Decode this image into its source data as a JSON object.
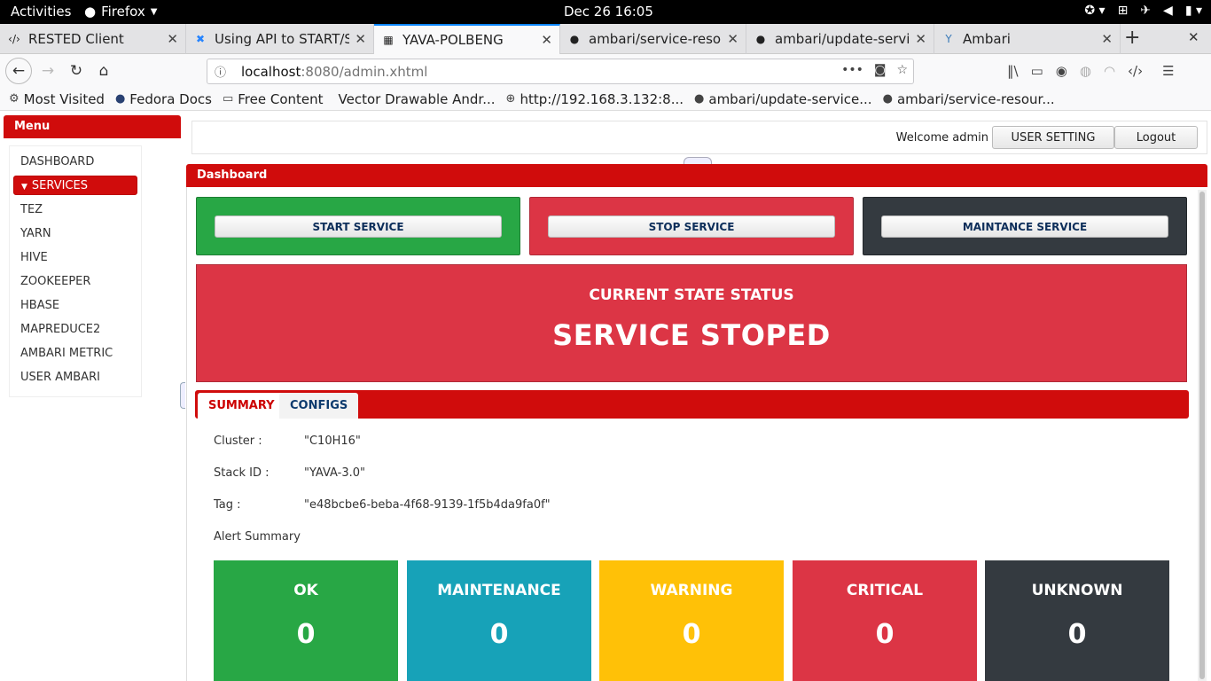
{
  "system_bar": {
    "activities": "Activities",
    "app_name": "Firefox",
    "clock": "Dec 26  16:05"
  },
  "browser": {
    "tabs": [
      {
        "title": "RESTED Client",
        "icon": "code-icon"
      },
      {
        "title": "Using API to START/ST",
        "icon": "confluence-icon"
      },
      {
        "title": "YAVA-POLBENG",
        "icon": "page-icon"
      },
      {
        "title": "ambari/service-resour",
        "icon": "github-icon"
      },
      {
        "title": "ambari/update-service",
        "icon": "github-icon"
      },
      {
        "title": "Ambari",
        "icon": "ambari-icon"
      }
    ],
    "url_host": "localhost",
    "url_rest": ":8080/admin.xhtml",
    "bookmarks": [
      {
        "label": "Most Visited",
        "icon": "gear-icon"
      },
      {
        "label": "Fedora Docs",
        "icon": "fedora-icon"
      },
      {
        "label": "Free Content",
        "icon": "folder-icon"
      },
      {
        "label": "Vector Drawable Andr...",
        "icon": "page-icon"
      },
      {
        "label": "http://192.168.3.132:8...",
        "icon": "globe-icon"
      },
      {
        "label": "ambari/update-service...",
        "icon": "github-icon"
      },
      {
        "label": "ambari/service-resour...",
        "icon": "github-icon"
      }
    ]
  },
  "menu": {
    "header": "Menu",
    "items": [
      "DASHBOARD",
      "SERVICES",
      "TEZ",
      "YARN",
      "HIVE",
      "ZOOKEEPER",
      "HBASE",
      "MAPREDUCE2",
      "AMBARI METRIC",
      "USER AMBARI"
    ]
  },
  "topbar": {
    "welcome": "Welcome admin",
    "user_setting": "USER SETTING",
    "logout": "Logout"
  },
  "dashboard": {
    "header": "Dashboard",
    "actions": {
      "start": "START SERVICE",
      "stop": "STOP SERVICE",
      "maintenance": "MAINTANCE SERVICE"
    },
    "state": {
      "title": "CURRENT STATE STATUS",
      "value": "SERVICE STOPED"
    },
    "tabs": {
      "summary": "SUMMARY",
      "configs": "CONFIGS"
    },
    "summary": {
      "cluster_label": "Cluster :",
      "cluster_value": "\"C10H16\"",
      "stack_label": "Stack ID :",
      "stack_value": "\"YAVA-3.0\"",
      "tag_label": "Tag :",
      "tag_value": "\"e48bcbe6-beba-4f68-9139-1f5b4da9fa0f\"",
      "alert_label": "Alert Summary"
    },
    "alerts": [
      {
        "label": "OK",
        "count": "0",
        "color": "#28a745"
      },
      {
        "label": "MAINTENANCE",
        "count": "0",
        "color": "#17a2b8"
      },
      {
        "label": "WARNING",
        "count": "0",
        "color": "#ffc107"
      },
      {
        "label": "CRITICAL",
        "count": "0",
        "color": "#dc3545"
      },
      {
        "label": "UNKNOWN",
        "count": "0",
        "color": "#343a40"
      }
    ]
  },
  "colors": {
    "brand_red": "#d00c0c",
    "start_green": "#28a745",
    "stop_red": "#dc3545",
    "maint_dark": "#343a40"
  }
}
